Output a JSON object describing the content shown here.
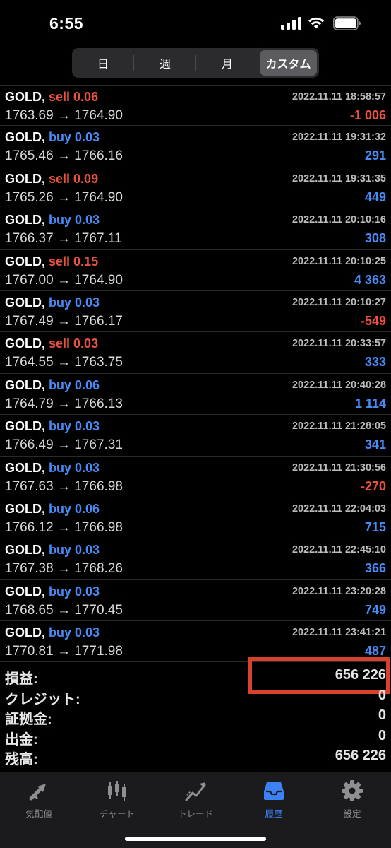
{
  "status_bar": {
    "time": "6:55"
  },
  "period_tabs": [
    {
      "label": "日",
      "selected": false
    },
    {
      "label": "週",
      "selected": false
    },
    {
      "label": "月",
      "selected": false
    },
    {
      "label": "カスタム",
      "selected": true
    }
  ],
  "deals": [
    {
      "symbol": "GOLD,",
      "type": "sell",
      "volume": "sell 0.06",
      "prices": "1763.69 → 1764.90",
      "time": "2022.11.11 18:58:57",
      "profit": "-1 006",
      "profit_sign": "neg"
    },
    {
      "symbol": "GOLD,",
      "type": "buy",
      "volume": "buy 0.03",
      "prices": "1765.46 → 1766.16",
      "time": "2022.11.11 19:31:32",
      "profit": "291",
      "profit_sign": "pos"
    },
    {
      "symbol": "GOLD,",
      "type": "sell",
      "volume": "sell 0.09",
      "prices": "1765.26 → 1764.90",
      "time": "2022.11.11 19:31:35",
      "profit": "449",
      "profit_sign": "pos"
    },
    {
      "symbol": "GOLD,",
      "type": "buy",
      "volume": "buy 0.03",
      "prices": "1766.37 → 1767.11",
      "time": "2022.11.11 20:10:16",
      "profit": "308",
      "profit_sign": "pos"
    },
    {
      "symbol": "GOLD,",
      "type": "sell",
      "volume": "sell 0.15",
      "prices": "1767.00 → 1764.90",
      "time": "2022.11.11 20:10:25",
      "profit": "4 363",
      "profit_sign": "pos"
    },
    {
      "symbol": "GOLD,",
      "type": "buy",
      "volume": "buy 0.03",
      "prices": "1767.49 → 1766.17",
      "time": "2022.11.11 20:10:27",
      "profit": "-549",
      "profit_sign": "neg"
    },
    {
      "symbol": "GOLD,",
      "type": "sell",
      "volume": "sell 0.03",
      "prices": "1764.55 → 1763.75",
      "time": "2022.11.11 20:33:57",
      "profit": "333",
      "profit_sign": "pos"
    },
    {
      "symbol": "GOLD,",
      "type": "buy",
      "volume": "buy 0.06",
      "prices": "1764.79 → 1766.13",
      "time": "2022.11.11 20:40:28",
      "profit": "1 114",
      "profit_sign": "pos"
    },
    {
      "symbol": "GOLD,",
      "type": "buy",
      "volume": "buy 0.03",
      "prices": "1766.49 → 1767.31",
      "time": "2022.11.11 21:28:05",
      "profit": "341",
      "profit_sign": "pos"
    },
    {
      "symbol": "GOLD,",
      "type": "buy",
      "volume": "buy 0.03",
      "prices": "1767.63 → 1766.98",
      "time": "2022.11.11 21:30:56",
      "profit": "-270",
      "profit_sign": "neg"
    },
    {
      "symbol": "GOLD,",
      "type": "buy",
      "volume": "buy 0.06",
      "prices": "1766.12 → 1766.98",
      "time": "2022.11.11 22:04:03",
      "profit": "715",
      "profit_sign": "pos"
    },
    {
      "symbol": "GOLD,",
      "type": "buy",
      "volume": "buy 0.03",
      "prices": "1767.38 → 1768.26",
      "time": "2022.11.11 22:45:10",
      "profit": "366",
      "profit_sign": "pos"
    },
    {
      "symbol": "GOLD,",
      "type": "buy",
      "volume": "buy 0.03",
      "prices": "1768.65 → 1770.45",
      "time": "2022.11.11 23:20:28",
      "profit": "749",
      "profit_sign": "pos"
    },
    {
      "symbol": "GOLD,",
      "type": "buy",
      "volume": "buy 0.03",
      "prices": "1770.81 → 1771.98",
      "time": "2022.11.11 23:41:21",
      "profit": "487",
      "profit_sign": "pos"
    }
  ],
  "summary": {
    "profit": {
      "label": "損益:",
      "value": "656 226"
    },
    "credit": {
      "label": "クレジット:",
      "value": "0"
    },
    "deposit": {
      "label": "証拠金:",
      "value": "0"
    },
    "withdrawal": {
      "label": "出金:",
      "value": "0"
    },
    "balance": {
      "label": "残高:",
      "value": "656 226"
    }
  },
  "tab_bar": [
    {
      "label": "気配値",
      "icon": "quotes-arrows-icon",
      "active": false
    },
    {
      "label": "チャート",
      "icon": "candlestick-chart-icon",
      "active": false
    },
    {
      "label": "トレード",
      "icon": "trade-line-icon",
      "active": false
    },
    {
      "label": "履歴",
      "icon": "history-inbox-icon",
      "active": true
    },
    {
      "label": "設定",
      "icon": "settings-gear-icon",
      "active": false
    }
  ],
  "colors": {
    "sell": "#e8523f",
    "buy": "#4a8af4",
    "negative": "#e8523f",
    "positive": "#4a8af4",
    "active_tab": "#3b82f6",
    "highlight_box": "#d8412b"
  }
}
